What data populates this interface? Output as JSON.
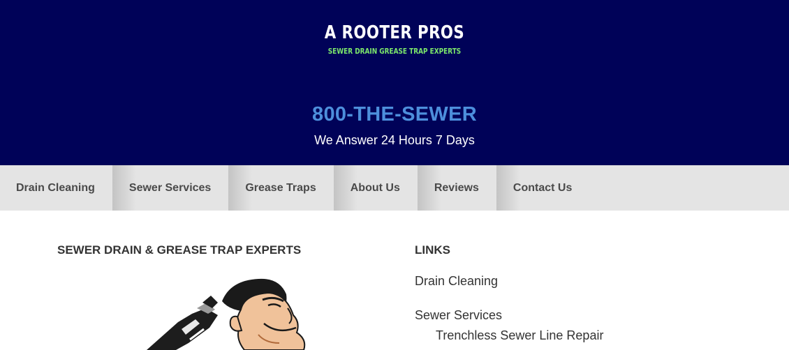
{
  "header": {
    "logo_title": "A ROOTER PROS",
    "logo_tagline": "SEWER DRAIN GREASE TRAP EXPERTS",
    "phone": "800-THE-SEWER",
    "hours": "We Answer 24 Hours 7 Days"
  },
  "nav": {
    "items": [
      {
        "label": "Drain Cleaning"
      },
      {
        "label": "Sewer Services"
      },
      {
        "label": "Grease Traps"
      },
      {
        "label": "About Us"
      },
      {
        "label": "Reviews"
      },
      {
        "label": "Contact Us"
      }
    ]
  },
  "main": {
    "heading": "SEWER DRAIN & GREASE TRAP EXPERTS"
  },
  "links": {
    "heading": "LINKS",
    "items": [
      {
        "label": "Drain Cleaning"
      },
      {
        "label": "Sewer Services"
      },
      {
        "label": "Trenchless Sewer Line Repair"
      }
    ]
  },
  "colors": {
    "header_bg": "#000258",
    "tagline": "#7de86b",
    "phone": "#4d8fdc",
    "nav_bg": "#e4e4e4"
  }
}
